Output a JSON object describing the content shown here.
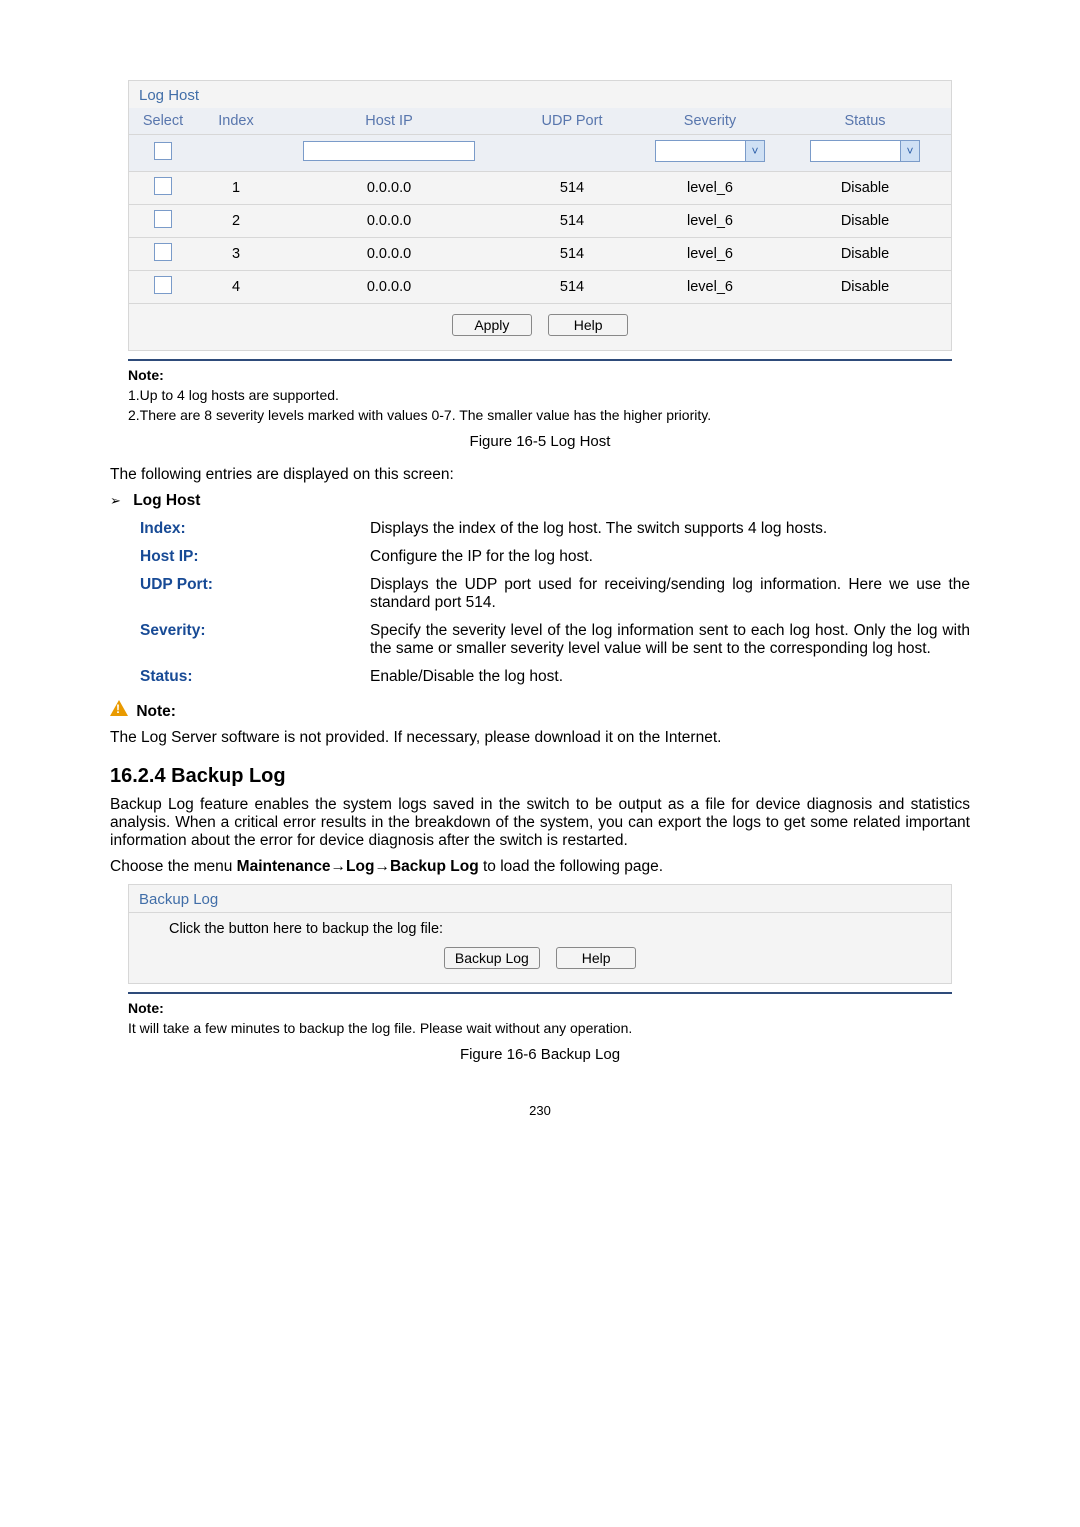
{
  "logHostPanel": {
    "title": "Log Host",
    "headers": [
      "Select",
      "Index",
      "Host IP",
      "UDP Port",
      "Severity",
      "Status"
    ],
    "rows": [
      {
        "index": "1",
        "hostip": "0.0.0.0",
        "udp": "514",
        "sev": "level_6",
        "status": "Disable"
      },
      {
        "index": "2",
        "hostip": "0.0.0.0",
        "udp": "514",
        "sev": "level_6",
        "status": "Disable"
      },
      {
        "index": "3",
        "hostip": "0.0.0.0",
        "udp": "514",
        "sev": "level_6",
        "status": "Disable"
      },
      {
        "index": "4",
        "hostip": "0.0.0.0",
        "udp": "514",
        "sev": "level_6",
        "status": "Disable"
      }
    ],
    "applyBtn": "Apply",
    "helpBtn": "Help"
  },
  "note1": {
    "heading": "Note:",
    "l1": "1.Up to 4 log hosts are supported.",
    "l2": "2.There are 8 severity levels marked with values 0-7. The smaller value has the higher priority."
  },
  "fig1": "Figure 16-5 Log Host",
  "lead": "The following entries are displayed on this screen:",
  "lhHeading": "Log Host",
  "defs": {
    "index": {
      "label": "Index:",
      "desc": "Displays the index of the log host. The switch supports 4 log hosts."
    },
    "hostip": {
      "label": "Host IP:",
      "desc": "Configure the IP for the log host."
    },
    "udp": {
      "label": "UDP Port:",
      "desc": "Displays the UDP port used for receiving/sending log information. Here we use the standard port 514."
    },
    "sev": {
      "label": "Severity:",
      "desc": "Specify the severity level of the log information sent to each log host. Only the log with the same or smaller severity level value will be sent to the corresponding log host."
    },
    "status": {
      "label": "Status:",
      "desc": "Enable/Disable the log host."
    }
  },
  "warnNote": {
    "label": "Note:",
    "text": "The Log Server software is not provided. If necessary, please download it on the Internet."
  },
  "sec": "16.2.4  Backup Log",
  "para1": "Backup Log feature enables the system logs saved in the switch to be output as a file for device diagnosis and statistics analysis. When a critical error results in the breakdown of the system, you can export the logs to get some related important information about the error for device diagnosis after the switch is restarted.",
  "para2a": "Choose the menu ",
  "para2b": "Maintenance→Log→Backup Log",
  "para2c": " to load the following page.",
  "backupPanel": {
    "title": "Backup Log",
    "line": "Click the button here to backup the log file:",
    "btn": "Backup Log",
    "help": "Help"
  },
  "note2": {
    "heading": "Note:",
    "text": "It will take a few minutes to backup the log file. Please wait without any operation."
  },
  "fig2": "Figure 16-6 Backup Log",
  "pagenum": "230"
}
